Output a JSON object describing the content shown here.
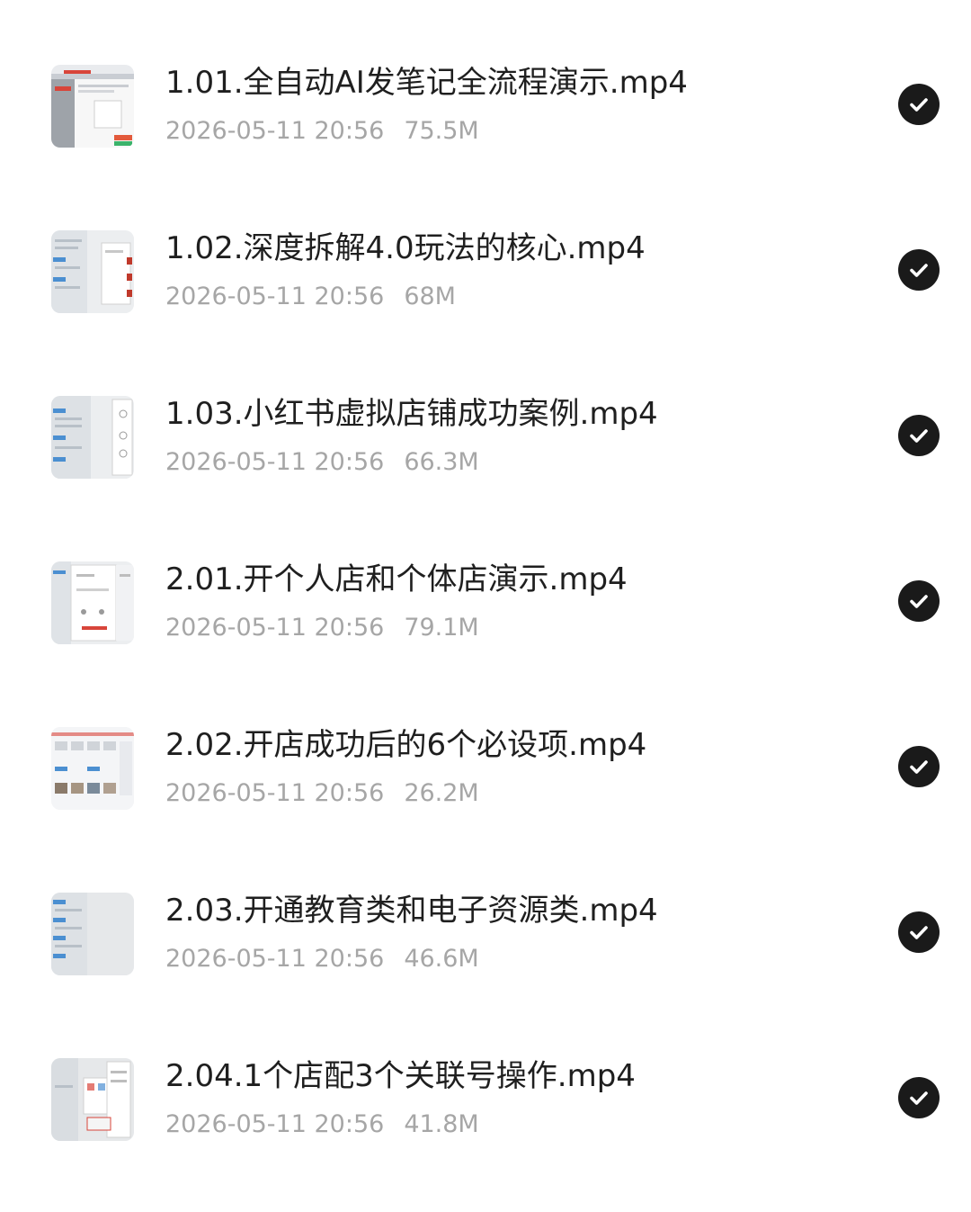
{
  "files": [
    {
      "name": "1.01.全自动AI发笔记全流程演示.mp4",
      "date": "2026-05-11 20:56",
      "size": "75.5M",
      "status_icon": "check-circle-icon"
    },
    {
      "name": "1.02.深度拆解4.0玩法的核心.mp4",
      "date": "2026-05-11 20:56",
      "size": "68M",
      "status_icon": "check-circle-icon"
    },
    {
      "name": "1.03.小红书虚拟店铺成功案例.mp4",
      "date": "2026-05-11 20:56",
      "size": "66.3M",
      "status_icon": "check-circle-icon"
    },
    {
      "name": "2.01.开个人店和个体店演示.mp4",
      "date": "2026-05-11 20:56",
      "size": "79.1M",
      "status_icon": "check-circle-icon"
    },
    {
      "name": "2.02.开店成功后的6个必设项.mp4",
      "date": "2026-05-11 20:56",
      "size": "26.2M",
      "status_icon": "check-circle-icon"
    },
    {
      "name": "2.03.开通教育类和电子资源类.mp4",
      "date": "2026-05-11 20:56",
      "size": "46.6M",
      "status_icon": "check-circle-icon"
    },
    {
      "name": "2.04.1个店配3个关联号操作.mp4",
      "date": "2026-05-11 20:56",
      "size": "41.8M",
      "status_icon": "check-circle-icon"
    }
  ]
}
